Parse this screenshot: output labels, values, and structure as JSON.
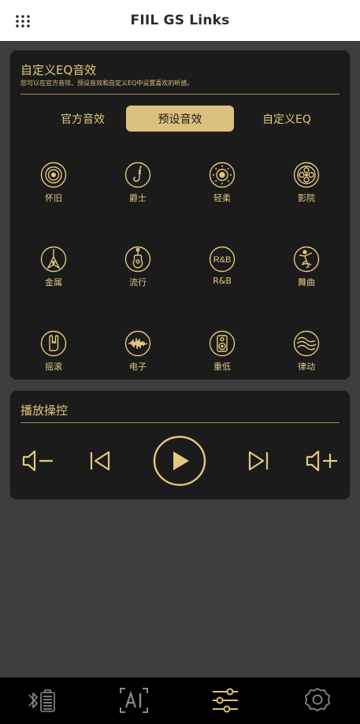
{
  "app": {
    "title": "FIIL GS Links"
  },
  "eq": {
    "title": "自定义EQ音效",
    "description": "您可以在官方音效、预设音效和自定义EQ中设置喜欢的听感。",
    "tabs": [
      {
        "label": "官方音效",
        "selected": false
      },
      {
        "label": "预设音效",
        "selected": true
      },
      {
        "label": "自定义EQ",
        "selected": false
      }
    ],
    "presets": [
      {
        "label": "怀旧",
        "icon": "vinyl-record-icon"
      },
      {
        "label": "爵士",
        "icon": "saxophone-icon"
      },
      {
        "label": "轻柔",
        "icon": "soft-circle-icon"
      },
      {
        "label": "影院",
        "icon": "film-reel-icon"
      },
      {
        "label": "金属",
        "icon": "electric-guitar-icon"
      },
      {
        "label": "流行",
        "icon": "acoustic-guitar-icon"
      },
      {
        "label": "R&B",
        "icon": "rnb-text-icon",
        "icon_text": "R&B"
      },
      {
        "label": "舞曲",
        "icon": "dancer-icon"
      },
      {
        "label": "摇滚",
        "icon": "rock-hand-icon"
      },
      {
        "label": "电子",
        "icon": "waveform-icon"
      },
      {
        "label": "重低",
        "icon": "speaker-icon"
      },
      {
        "label": "律动",
        "icon": "waves-icon"
      }
    ]
  },
  "playback": {
    "title": "播放操控",
    "controls": [
      "volume-down-icon",
      "previous-track-icon",
      "play-icon",
      "next-track-icon",
      "volume-up-icon"
    ]
  },
  "bottom_nav": {
    "items": [
      "bluetooth-battery-icon",
      "ai-icon",
      "equalizer-sliders-icon",
      "settings-gear-icon"
    ],
    "active_index": 2
  },
  "colors": {
    "gold": "#e2c77d",
    "tab_selected_bg": "#dcc07e",
    "panel_bg": "#1b1b1b",
    "page_bg": "#3d3d3d",
    "nav_inactive": "#8a8a8a"
  }
}
